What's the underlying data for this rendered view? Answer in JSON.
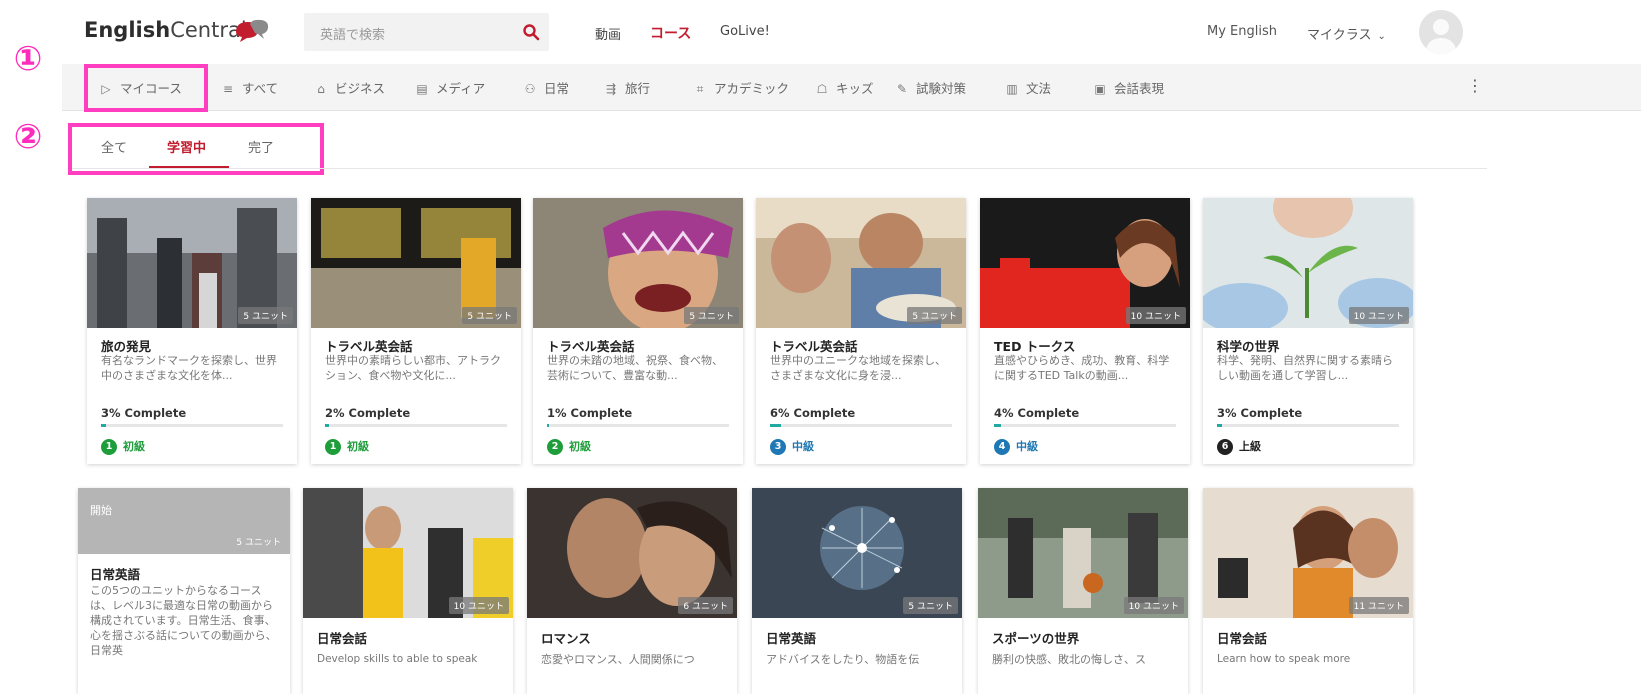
{
  "annotations": {
    "marker1": "①",
    "marker2": "②"
  },
  "header": {
    "logo_bold": "English",
    "logo_light": "Central",
    "search_placeholder": "英語で検索",
    "nav": [
      "動画",
      "コース",
      "GoLive!"
    ],
    "my_english": "My English",
    "my_class": "マイクラス"
  },
  "categories": [
    {
      "icon": "play-icon",
      "glyph": "▷",
      "label": "マイコース"
    },
    {
      "icon": "list-icon",
      "glyph": "≡",
      "label": "すべて"
    },
    {
      "icon": "building-icon",
      "glyph": "⌂",
      "label": "ビジネス"
    },
    {
      "icon": "media-icon",
      "glyph": "▤",
      "label": "メディア"
    },
    {
      "icon": "people-icon",
      "glyph": "⚇",
      "label": "日常"
    },
    {
      "icon": "signpost-icon",
      "glyph": "⇶",
      "label": "旅行"
    },
    {
      "icon": "academic-icon",
      "glyph": "⌗",
      "label": "アカデミック"
    },
    {
      "icon": "kids-icon",
      "glyph": "☖",
      "label": "キッズ"
    },
    {
      "icon": "exam-icon",
      "glyph": "✎",
      "label": "試験対策"
    },
    {
      "icon": "grammar-icon",
      "glyph": "▥",
      "label": "文法"
    },
    {
      "icon": "phrase-icon",
      "glyph": "▣",
      "label": "会話表現"
    }
  ],
  "tabs": [
    "全て",
    "学習中",
    "完了"
  ],
  "row1": [
    {
      "title": "旅の発見",
      "desc": "有名なランドマークを探索し、世界中のさまざまな文化を体...",
      "units": "5 ユニット",
      "progress_label": "3% Complete",
      "progress": 0.03,
      "level_num": "1",
      "level": "初級",
      "level_color": "#1e9e3b"
    },
    {
      "title": "トラベル英会話",
      "desc": "世界中の素晴らしい都市、アトラクション、食べ物や文化に...",
      "units": "5 ユニット",
      "progress_label": "2% Complete",
      "progress": 0.02,
      "level_num": "1",
      "level": "初級",
      "level_color": "#1e9e3b"
    },
    {
      "title": "トラベル英会話",
      "desc": "世界の未踏の地域、祝祭、食べ物、芸術について、豊富な動...",
      "units": "5 ユニット",
      "progress_label": "1% Complete",
      "progress": 0.01,
      "level_num": "2",
      "level": "初級",
      "level_color": "#1e9e3b"
    },
    {
      "title": "トラベル英会話",
      "desc": "世界中のユニークな地域を探索し、さまざまな文化に身を浸...",
      "units": "5 ユニット",
      "progress_label": "6% Complete",
      "progress": 0.06,
      "level_num": "3",
      "level": "中級",
      "level_color": "#1f78b4"
    },
    {
      "title": "TED トークス",
      "desc": "直感やひらめき、成功、教育、科学に関するTED Talkの動画...",
      "units": "10 ユニット",
      "progress_label": "4% Complete",
      "progress": 0.04,
      "level_num": "4",
      "level": "中級",
      "level_color": "#1f78b4"
    },
    {
      "title": "科学の世界",
      "desc": "科学、発明、自然界に関する素晴らしい動画を通して学習し...",
      "units": "10 ユニット",
      "progress_label": "3% Complete",
      "progress": 0.03,
      "level_num": "6",
      "level": "上級",
      "level_color": "#222222"
    }
  ],
  "row2_first": {
    "start_label": "開始",
    "units": "5 ユニット",
    "title": "日常英語",
    "desc": "この5つのユニットからなるコースは、レベル3に最適な日常の動画から構成されています。日常生活、食事、心を揺さぶる話についての動画から、日常英"
  },
  "row2": [
    {
      "title": "日常会話",
      "desc": "Develop skills to able to speak",
      "units": "10 ユニット"
    },
    {
      "title": "ロマンス",
      "desc": "恋愛やロマンス、人間関係につ",
      "units": "6 ユニット"
    },
    {
      "title": "日常英語",
      "desc": "アドバイスをしたり、物語を伝",
      "units": "5 ユニット"
    },
    {
      "title": "スポーツの世界",
      "desc": "勝利の快感、敗北の悔しさ、ス",
      "units": "10 ユニット"
    },
    {
      "title": "日常会話",
      "desc": "Learn how to speak more",
      "units": "11 ユニット"
    }
  ]
}
